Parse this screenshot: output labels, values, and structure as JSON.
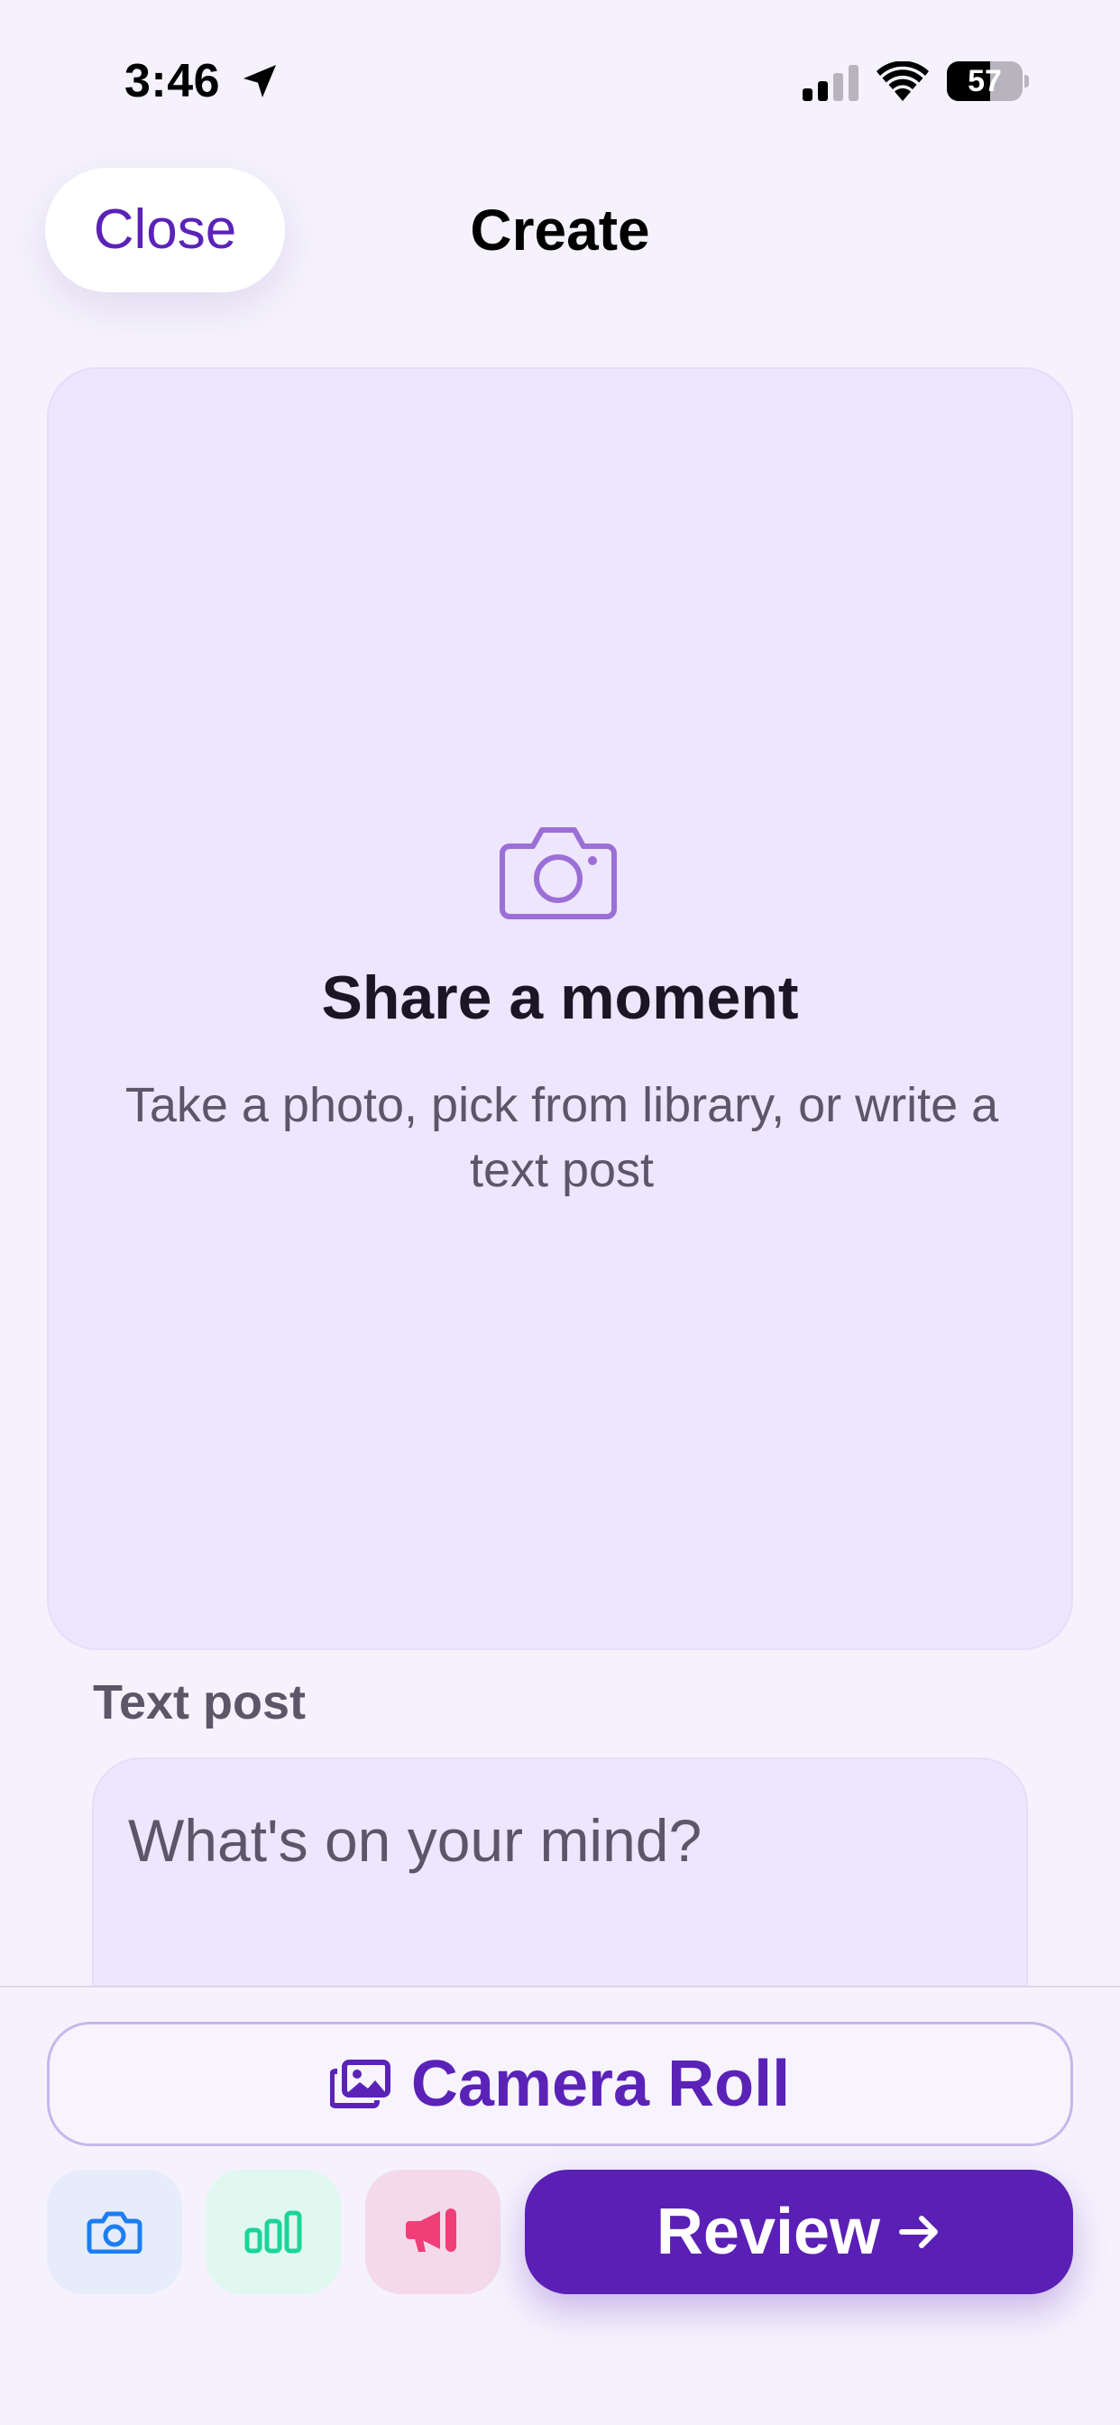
{
  "status_bar": {
    "time": "3:46",
    "battery_text": "57",
    "battery_level": 0.57,
    "icons": [
      "location-arrow-icon",
      "cellular-signal-icon",
      "wifi-icon",
      "battery-icon"
    ]
  },
  "header": {
    "close_label": "Close",
    "title": "Create"
  },
  "media_card": {
    "icon": "camera-icon",
    "title": "Share a moment",
    "subtitle": "Take a photo, pick from library, or write a text post"
  },
  "text_post": {
    "label": "Text post",
    "placeholder": "What's on your mind?",
    "value": ""
  },
  "bottom_bar": {
    "camera_roll_label": "Camera Roll",
    "camera_roll_icon": "photos-icon",
    "actions": [
      {
        "icon": "camera-icon",
        "color": "#1c7ef0"
      },
      {
        "icon": "bar-chart-icon",
        "color": "#1ed39a"
      },
      {
        "icon": "megaphone-icon",
        "color": "#f03e78"
      }
    ],
    "review_label": "Review",
    "review_icon": "arrow-right-icon"
  },
  "colors": {
    "background": "#f5f2fd",
    "accent": "#5a1fb5",
    "card": "#ede6fc",
    "muted_text": "#5d5568"
  }
}
